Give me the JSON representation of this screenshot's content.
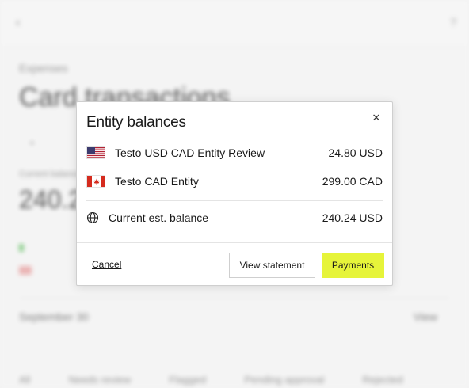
{
  "background": {
    "breadcrumb": "Expenses",
    "title": "Card transactions",
    "balance_small_label": "Current balance",
    "amount": "240.24",
    "date_label": "September 30",
    "view_label": "View",
    "tabs": [
      "All",
      "Needs review",
      "Flagged",
      "Pending approval",
      "Rejected"
    ]
  },
  "modal": {
    "title": "Entity balances",
    "close_icon": "close-icon",
    "entities": [
      {
        "flag": "us-flag-icon",
        "name": "Testo USD CAD Entity Review",
        "amount": "24.80 USD"
      },
      {
        "flag": "ca-flag-icon",
        "name": "Testo CAD Entity",
        "amount": "299.00 CAD"
      }
    ],
    "total": {
      "icon": "globe-icon",
      "label": "Current est. balance",
      "amount": "240.24 USD"
    },
    "cancel_label": "Cancel",
    "statement_label": "View statement",
    "payments_label": "Payments"
  },
  "colors": {
    "accent": "#e6f43a"
  }
}
